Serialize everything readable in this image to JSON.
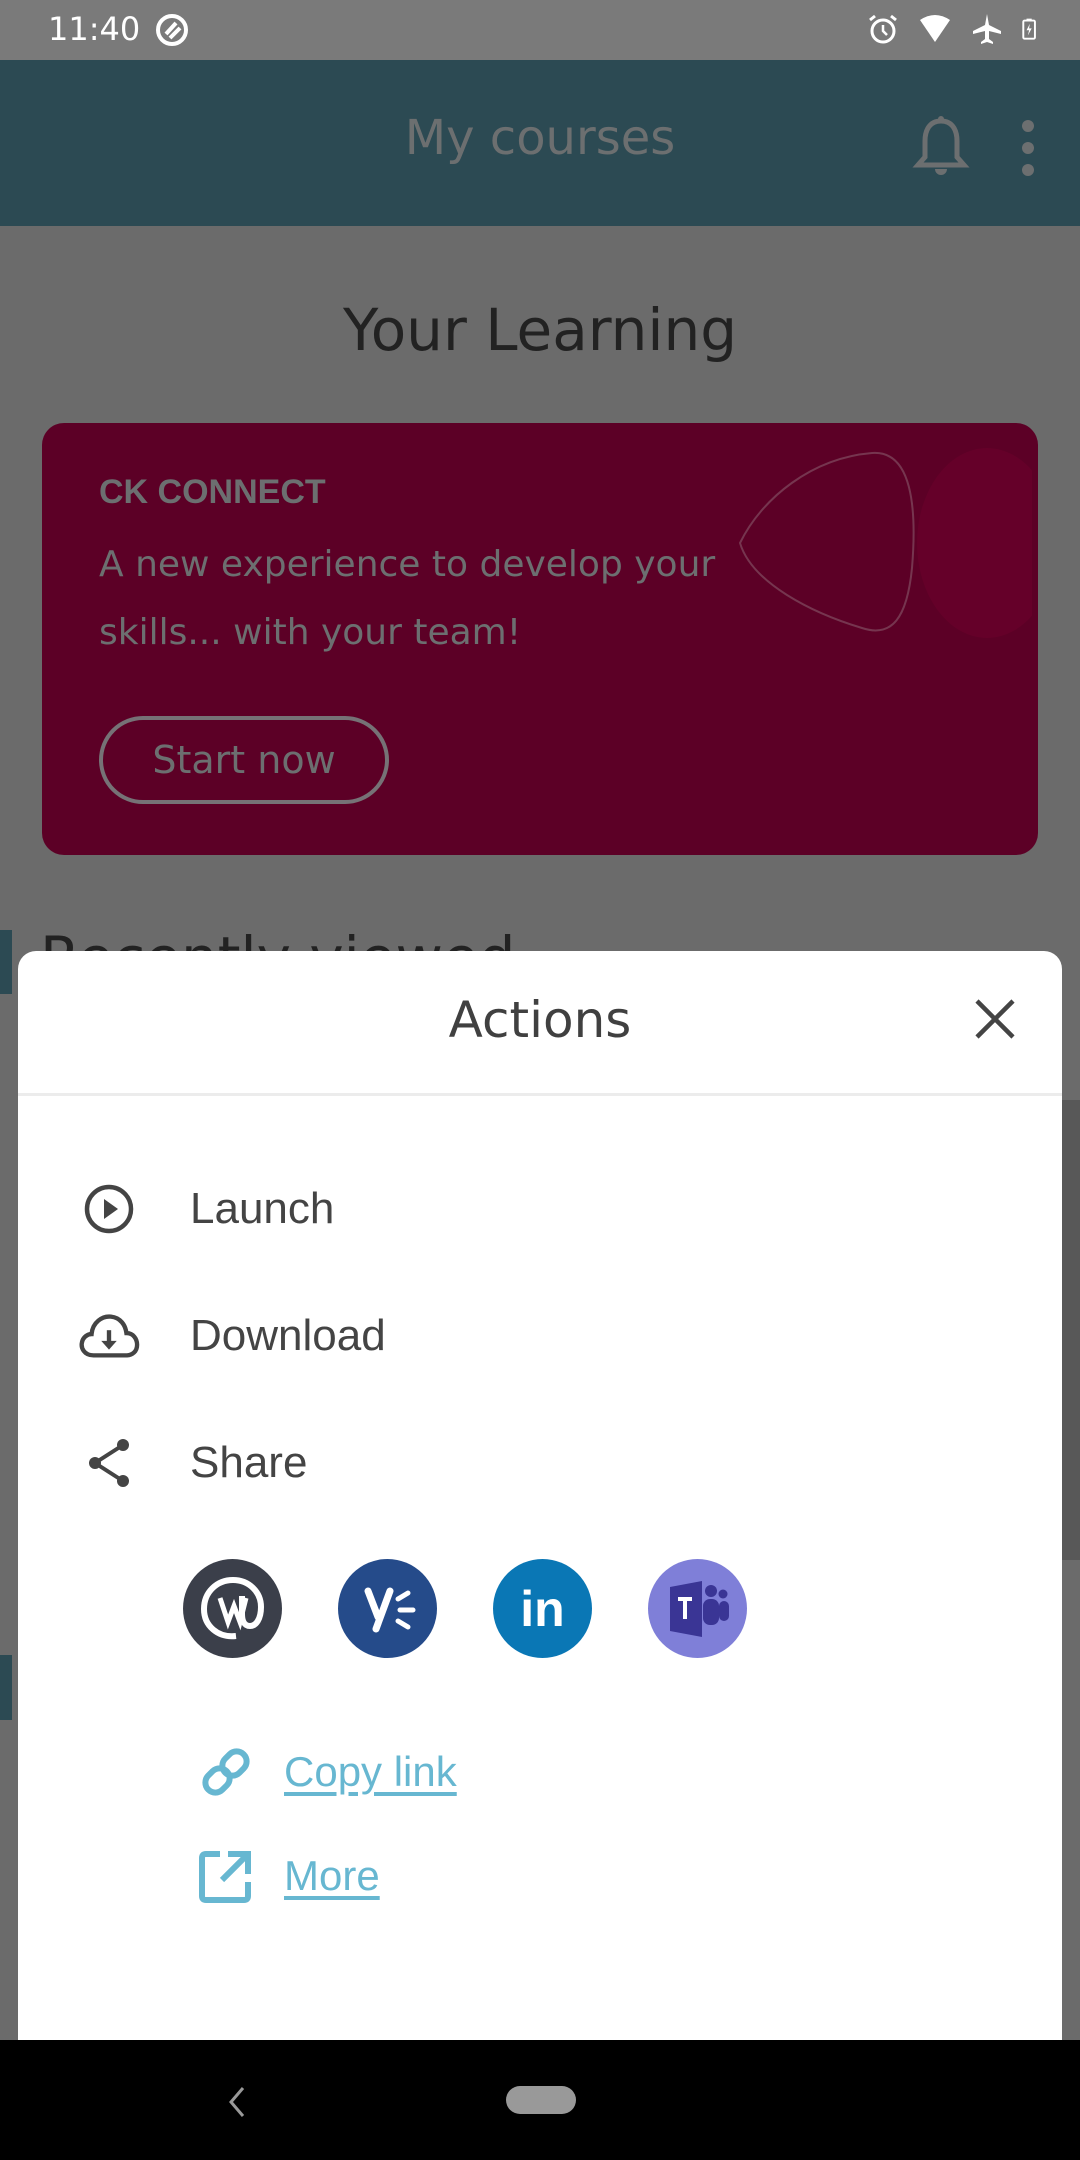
{
  "status_bar": {
    "time": "11:40",
    "left_icons": [
      "app-notification-icon"
    ],
    "right_icons": [
      "alarm-icon",
      "wifi-icon",
      "airplane-mode-icon",
      "battery-charging-icon"
    ]
  },
  "app_bar": {
    "title": "My courses",
    "icons": [
      "bell-icon",
      "more-vert-icon"
    ],
    "color": "#2c4a53"
  },
  "page": {
    "heading": "Your Learning",
    "promo": {
      "kicker": "CK CONNECT",
      "description": "A new experience to develop your skills... with your team!",
      "button_label": "Start now",
      "color": "#5c0026"
    },
    "section_title_partial": "Recently viewed"
  },
  "sheet": {
    "title": "Actions",
    "close_icon": "close-icon",
    "actions": [
      {
        "label": "Launch",
        "icon": "play-circle-icon"
      },
      {
        "label": "Download",
        "icon": "cloud-download-icon"
      },
      {
        "label": "Share",
        "icon": "share-icon"
      }
    ],
    "share_targets": [
      {
        "name": "Workplace",
        "icon": "workplace-icon",
        "color": "#3b3f4a"
      },
      {
        "name": "Yammer",
        "icon": "yammer-icon",
        "color": "#254b8a"
      },
      {
        "name": "LinkedIn",
        "icon": "linkedin-icon",
        "color": "#0a77b5"
      },
      {
        "name": "Microsoft Teams",
        "icon": "teams-icon",
        "color": "#7f7fd8"
      }
    ],
    "links": [
      {
        "label": "Copy link",
        "icon": "link-icon"
      },
      {
        "label": "More",
        "icon": "open-external-icon"
      }
    ],
    "link_color": "#67b7d1"
  },
  "nav_bar": {
    "icons": [
      "back-icon",
      "home-pill"
    ]
  }
}
